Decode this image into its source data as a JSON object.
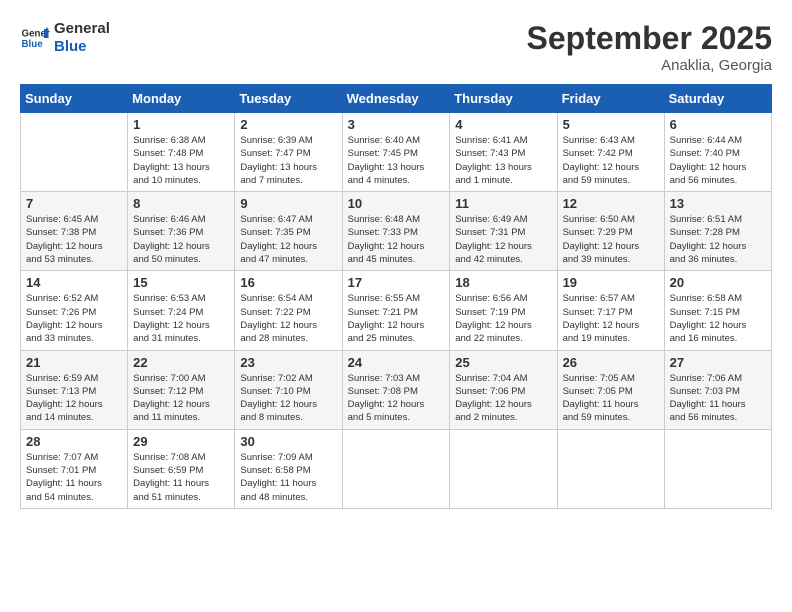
{
  "header": {
    "logo_line1": "General",
    "logo_line2": "Blue",
    "month_year": "September 2025",
    "location": "Anaklia, Georgia"
  },
  "weekdays": [
    "Sunday",
    "Monday",
    "Tuesday",
    "Wednesday",
    "Thursday",
    "Friday",
    "Saturday"
  ],
  "weeks": [
    [
      {
        "day": "",
        "info": ""
      },
      {
        "day": "1",
        "info": "Sunrise: 6:38 AM\nSunset: 7:48 PM\nDaylight: 13 hours\nand 10 minutes."
      },
      {
        "day": "2",
        "info": "Sunrise: 6:39 AM\nSunset: 7:47 PM\nDaylight: 13 hours\nand 7 minutes."
      },
      {
        "day": "3",
        "info": "Sunrise: 6:40 AM\nSunset: 7:45 PM\nDaylight: 13 hours\nand 4 minutes."
      },
      {
        "day": "4",
        "info": "Sunrise: 6:41 AM\nSunset: 7:43 PM\nDaylight: 13 hours\nand 1 minute."
      },
      {
        "day": "5",
        "info": "Sunrise: 6:43 AM\nSunset: 7:42 PM\nDaylight: 12 hours\nand 59 minutes."
      },
      {
        "day": "6",
        "info": "Sunrise: 6:44 AM\nSunset: 7:40 PM\nDaylight: 12 hours\nand 56 minutes."
      }
    ],
    [
      {
        "day": "7",
        "info": "Sunrise: 6:45 AM\nSunset: 7:38 PM\nDaylight: 12 hours\nand 53 minutes."
      },
      {
        "day": "8",
        "info": "Sunrise: 6:46 AM\nSunset: 7:36 PM\nDaylight: 12 hours\nand 50 minutes."
      },
      {
        "day": "9",
        "info": "Sunrise: 6:47 AM\nSunset: 7:35 PM\nDaylight: 12 hours\nand 47 minutes."
      },
      {
        "day": "10",
        "info": "Sunrise: 6:48 AM\nSunset: 7:33 PM\nDaylight: 12 hours\nand 45 minutes."
      },
      {
        "day": "11",
        "info": "Sunrise: 6:49 AM\nSunset: 7:31 PM\nDaylight: 12 hours\nand 42 minutes."
      },
      {
        "day": "12",
        "info": "Sunrise: 6:50 AM\nSunset: 7:29 PM\nDaylight: 12 hours\nand 39 minutes."
      },
      {
        "day": "13",
        "info": "Sunrise: 6:51 AM\nSunset: 7:28 PM\nDaylight: 12 hours\nand 36 minutes."
      }
    ],
    [
      {
        "day": "14",
        "info": "Sunrise: 6:52 AM\nSunset: 7:26 PM\nDaylight: 12 hours\nand 33 minutes."
      },
      {
        "day": "15",
        "info": "Sunrise: 6:53 AM\nSunset: 7:24 PM\nDaylight: 12 hours\nand 31 minutes."
      },
      {
        "day": "16",
        "info": "Sunrise: 6:54 AM\nSunset: 7:22 PM\nDaylight: 12 hours\nand 28 minutes."
      },
      {
        "day": "17",
        "info": "Sunrise: 6:55 AM\nSunset: 7:21 PM\nDaylight: 12 hours\nand 25 minutes."
      },
      {
        "day": "18",
        "info": "Sunrise: 6:56 AM\nSunset: 7:19 PM\nDaylight: 12 hours\nand 22 minutes."
      },
      {
        "day": "19",
        "info": "Sunrise: 6:57 AM\nSunset: 7:17 PM\nDaylight: 12 hours\nand 19 minutes."
      },
      {
        "day": "20",
        "info": "Sunrise: 6:58 AM\nSunset: 7:15 PM\nDaylight: 12 hours\nand 16 minutes."
      }
    ],
    [
      {
        "day": "21",
        "info": "Sunrise: 6:59 AM\nSunset: 7:13 PM\nDaylight: 12 hours\nand 14 minutes."
      },
      {
        "day": "22",
        "info": "Sunrise: 7:00 AM\nSunset: 7:12 PM\nDaylight: 12 hours\nand 11 minutes."
      },
      {
        "day": "23",
        "info": "Sunrise: 7:02 AM\nSunset: 7:10 PM\nDaylight: 12 hours\nand 8 minutes."
      },
      {
        "day": "24",
        "info": "Sunrise: 7:03 AM\nSunset: 7:08 PM\nDaylight: 12 hours\nand 5 minutes."
      },
      {
        "day": "25",
        "info": "Sunrise: 7:04 AM\nSunset: 7:06 PM\nDaylight: 12 hours\nand 2 minutes."
      },
      {
        "day": "26",
        "info": "Sunrise: 7:05 AM\nSunset: 7:05 PM\nDaylight: 11 hours\nand 59 minutes."
      },
      {
        "day": "27",
        "info": "Sunrise: 7:06 AM\nSunset: 7:03 PM\nDaylight: 11 hours\nand 56 minutes."
      }
    ],
    [
      {
        "day": "28",
        "info": "Sunrise: 7:07 AM\nSunset: 7:01 PM\nDaylight: 11 hours\nand 54 minutes."
      },
      {
        "day": "29",
        "info": "Sunrise: 7:08 AM\nSunset: 6:59 PM\nDaylight: 11 hours\nand 51 minutes."
      },
      {
        "day": "30",
        "info": "Sunrise: 7:09 AM\nSunset: 6:58 PM\nDaylight: 11 hours\nand 48 minutes."
      },
      {
        "day": "",
        "info": ""
      },
      {
        "day": "",
        "info": ""
      },
      {
        "day": "",
        "info": ""
      },
      {
        "day": "",
        "info": ""
      }
    ]
  ]
}
